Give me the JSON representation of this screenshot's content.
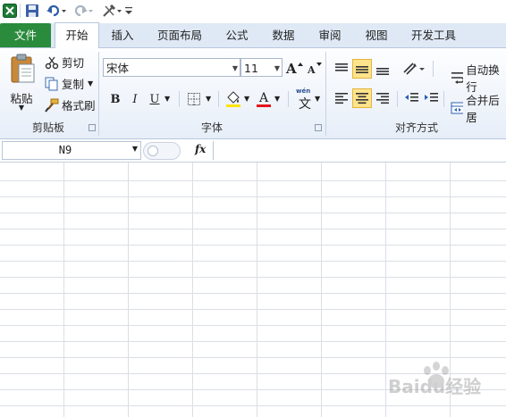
{
  "app": {
    "accent_color": "#2a8b3d",
    "icon": "excel-icon"
  },
  "quick_access": [
    {
      "icon": "save-icon"
    },
    {
      "icon": "undo-icon"
    },
    {
      "icon": "redo-icon"
    },
    {
      "icon": "tools-icon"
    },
    {
      "icon": "customize-icon"
    }
  ],
  "tabs": {
    "file": "文件",
    "home": "开始",
    "insert": "插入",
    "page_layout": "页面布局",
    "formulas": "公式",
    "data": "数据",
    "review": "审阅",
    "view": "视图",
    "developer": "开发工具"
  },
  "clipboard": {
    "paste": "粘贴",
    "cut": "剪切",
    "copy": "复制",
    "format_painter": "格式刷",
    "label": "剪贴板"
  },
  "font": {
    "name": "宋体",
    "size": "11",
    "bold": "B",
    "italic": "I",
    "underline": "U",
    "font_color_glyph": "A",
    "phonetic": "文",
    "label": "字体"
  },
  "alignment": {
    "wrap_text": "自动换行",
    "merge_center": "合并后居",
    "label": "对齐方式"
  },
  "formula_bar": {
    "cell_ref": "N9",
    "fx": "fx",
    "content": ""
  },
  "watermark": "Baidu经验"
}
